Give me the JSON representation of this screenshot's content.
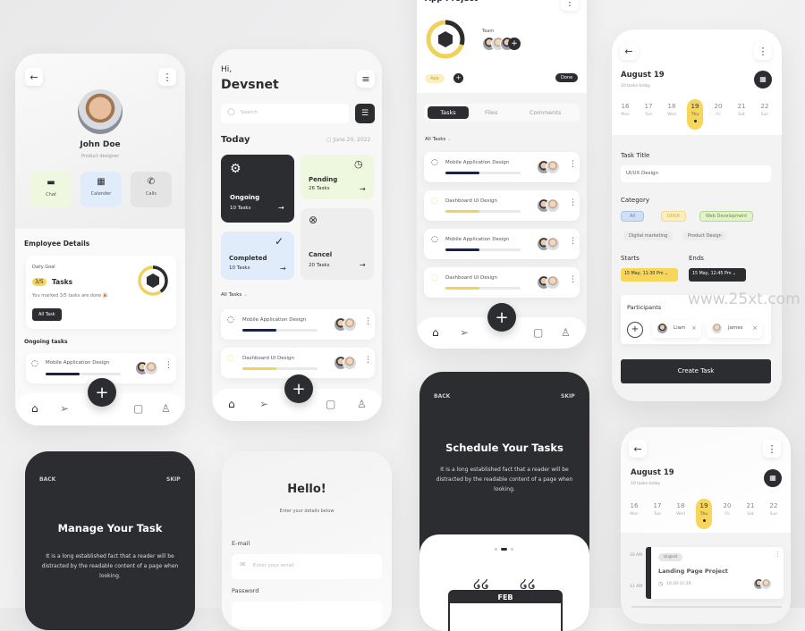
{
  "watermark": "www.25xt.com",
  "profile": {
    "name": "John Doe",
    "role": "Product designer",
    "actions": [
      {
        "label": "Chat",
        "icon": "chat-icon"
      },
      {
        "label": "Calender",
        "icon": "calendar-icon"
      },
      {
        "label": "Calls",
        "icon": "phone-icon"
      }
    ],
    "section_title": "Employee Details",
    "goal": {
      "label": "Daily Goal",
      "badge": "3/5",
      "title": "Tasks",
      "note": "You marked 3/5 tasks are done 🎉",
      "button": "All Task",
      "progress": 0.6
    },
    "ongoing_title": "Ongoing tasks",
    "task": {
      "title": "Mobile Application Design",
      "progress": 0.45
    }
  },
  "home": {
    "greeting": "Hi,",
    "name": "Devsnet",
    "search_placeholder": "Search",
    "today": "Today",
    "date": "June 20, 2022",
    "stats": [
      {
        "label": "Ongoing",
        "count": "10 Tasks"
      },
      {
        "label": "Pending",
        "count": "26 Tasks"
      },
      {
        "label": "Completed",
        "count": "10 Tasks"
      },
      {
        "label": "Cancel",
        "count": "20 Tasks"
      }
    ],
    "filter": "All Tasks",
    "tasks": [
      {
        "title": "Mobile Application Design",
        "progress": 0.45
      },
      {
        "title": "Dashboard UI Design",
        "progress": 0.45
      }
    ]
  },
  "project": {
    "title": "App Project",
    "team_label": "Team",
    "tag": "App",
    "status": "Done",
    "progress": 0.7,
    "tabs": [
      "Tasks",
      "Files",
      "Comments"
    ],
    "filter": "All Tasks",
    "tasks": [
      {
        "title": "Mobile Application Design",
        "progress": 0.45
      },
      {
        "title": "Dashboard UI Design",
        "progress": 0.45
      },
      {
        "title": "Mobile Application Design",
        "progress": 0.45
      },
      {
        "title": "Dashboard UI Design",
        "progress": 0.45
      }
    ]
  },
  "create": {
    "month": "August 19",
    "subtitle": "10 tasks today",
    "days": [
      {
        "n": "16",
        "d": "Mon"
      },
      {
        "n": "17",
        "d": "Tue"
      },
      {
        "n": "18",
        "d": "Wed"
      },
      {
        "n": "19",
        "d": "Thu"
      },
      {
        "n": "20",
        "d": "Fri"
      },
      {
        "n": "21",
        "d": "Sat"
      },
      {
        "n": "22",
        "d": "Sun"
      }
    ],
    "task_title_label": "Task Title",
    "task_title_value": "UI/UX Design",
    "category_label": "Category",
    "categories": [
      "All",
      "UI/UX",
      "Web Development",
      "Digital marketing",
      "Product Design"
    ],
    "starts_label": "Starts",
    "starts_value": "15 May, 11:30 Pm",
    "ends_label": "Ends",
    "ends_value": "15 May, 12:45 Pm",
    "participants_label": "Participants",
    "participants": [
      "Liam",
      "James"
    ],
    "button": "Create Task"
  },
  "onboard1": {
    "back": "BACK",
    "skip": "SKIP",
    "title": "Manage Your Task",
    "body": "It is a long established fact that a reader will be distracted by the readable content of a page when looking."
  },
  "login": {
    "title": "Hello!",
    "subtitle": "Enter your details below",
    "email_label": "E-mail",
    "email_placeholder": "Enter your email",
    "password_label": "Password"
  },
  "onboard2": {
    "back": "BACK",
    "skip": "SKIP",
    "title": "Schedule Your Tasks",
    "body": "It is a long established fact that a reader will be distracted by the readable content of a page when looking.",
    "illustration_label": "FEB"
  },
  "schedule": {
    "month": "August 19",
    "subtitle": "10 tasks today",
    "days": [
      {
        "n": "16",
        "d": "Mon"
      },
      {
        "n": "17",
        "d": "Tue"
      },
      {
        "n": "18",
        "d": "Wed"
      },
      {
        "n": "19",
        "d": "Thu"
      },
      {
        "n": "20",
        "d": "Fri"
      },
      {
        "n": "21",
        "d": "Sat"
      },
      {
        "n": "22",
        "d": "Sun"
      }
    ],
    "time_top": "10 AM",
    "time_bottom": "11 AM",
    "event": {
      "badge": "Urgent",
      "title": "Landing Page Project",
      "time": "10:20-11:20"
    }
  },
  "colors": {
    "dark": "#2b2d30",
    "yellow": "#f7d65a",
    "green": "#eef8df",
    "blue": "#e1ecfb",
    "navy": "#1c2147"
  }
}
